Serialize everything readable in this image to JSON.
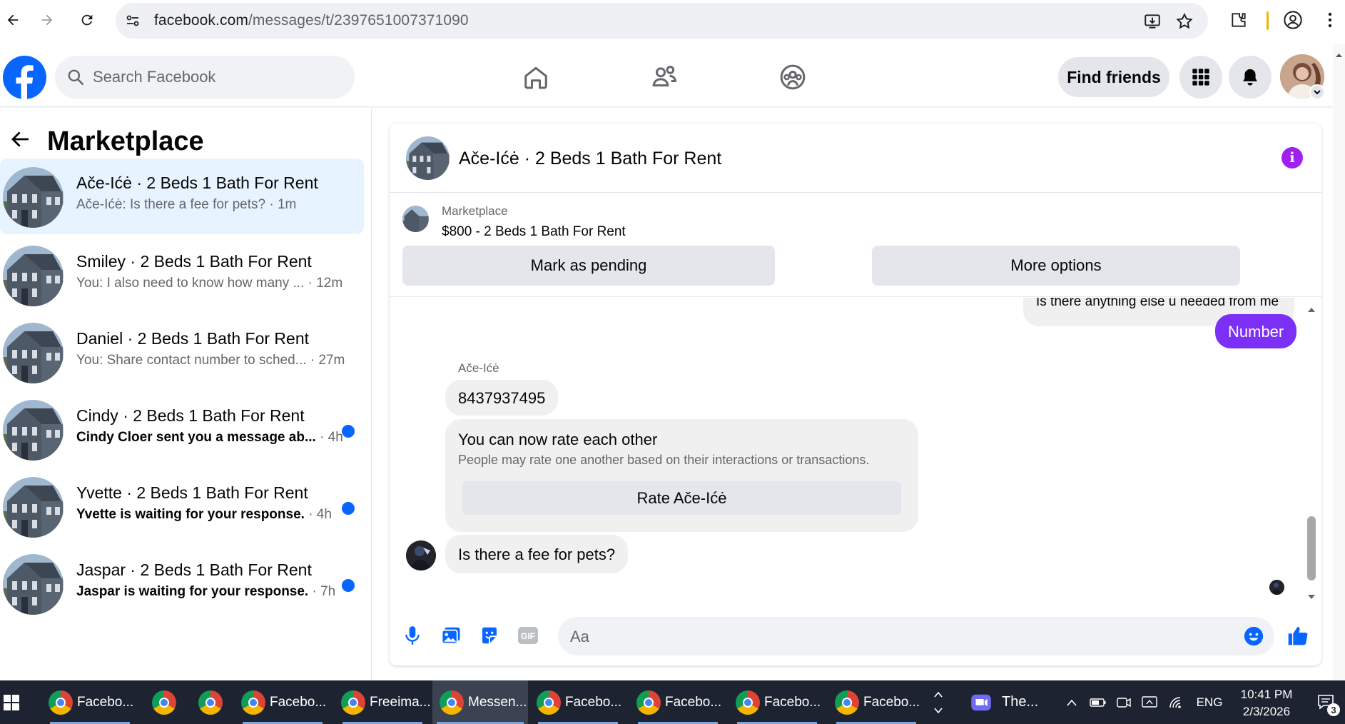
{
  "browser": {
    "url_host": "facebook.com",
    "url_path": "/messages/t/2397651007371090"
  },
  "fb": {
    "search_placeholder": "Search Facebook",
    "find_friends_label": "Find friends"
  },
  "sidebar": {
    "title": "Marketplace",
    "conversations": [
      {
        "name": "Ače-Ićė · 2 Beds 1 Bath For Rent",
        "snippet": "Ače-Ićė: Is there a fee for pets?",
        "time": " · 1m",
        "unread": false,
        "active": true
      },
      {
        "name": "Smiley · 2 Beds 1 Bath For Rent",
        "snippet": "You: I also need to know how many ...",
        "time": " · 12m",
        "unread": false,
        "active": false
      },
      {
        "name": "Daniel · 2 Beds 1 Bath For Rent",
        "snippet": "You: Share contact number to sched...",
        "time": " · 27m",
        "unread": false,
        "active": false
      },
      {
        "name": "Cindy · 2 Beds 1 Bath For Rent",
        "snippet": "Cindy Cloer sent you a message ab...",
        "time": " · 4h",
        "unread": true,
        "active": false
      },
      {
        "name": "Yvette · 2 Beds 1 Bath For Rent",
        "snippet": "Yvette is waiting for your response.",
        "time": " · 4h",
        "unread": true,
        "active": false
      },
      {
        "name": "Jaspar · 2 Beds 1 Bath For Rent",
        "snippet": "Jaspar is waiting for your response.",
        "time": " · 7h",
        "unread": true,
        "active": false
      }
    ]
  },
  "chat": {
    "title": "Ače-Ićė · 2 Beds 1 Bath For Rent",
    "listing_label": "Marketplace",
    "listing_title": "$800 - 2 Beds 1 Bath For Rent",
    "mark_pending_label": "Mark as pending",
    "more_options_label": "More options",
    "messages": {
      "partial_out": "Is there anything else u needed from me",
      "number_out": "Number",
      "sender_name": "Ače-Ićė",
      "phone_in": "8437937495",
      "rate_title": "You can now rate each other",
      "rate_subtitle": "People may rate one another based on their interactions or transactions.",
      "rate_button": "Rate Ače-Ićė",
      "pets_in": "Is there a fee for pets?"
    },
    "composer_placeholder": "Aa"
  },
  "taskbar": {
    "items": [
      {
        "label": "Facebo..."
      },
      {
        "label": ""
      },
      {
        "label": ""
      },
      {
        "label": "Facebo..."
      },
      {
        "label": "Freeima..."
      },
      {
        "label": "Messen..."
      },
      {
        "label": "Facebo..."
      },
      {
        "label": "Facebo..."
      },
      {
        "label": "Facebo..."
      },
      {
        "label": "Facebo..."
      }
    ],
    "zoom_label": "The...",
    "language": "ENG",
    "time": "10:41 PM",
    "date": "2/3/2026",
    "notification_count": "3"
  },
  "colors": {
    "fb_blue": "#0866ff",
    "messenger_purple": "#7b2ff7",
    "info_purple": "#a020f0",
    "unread_dot": "#0866ff"
  }
}
